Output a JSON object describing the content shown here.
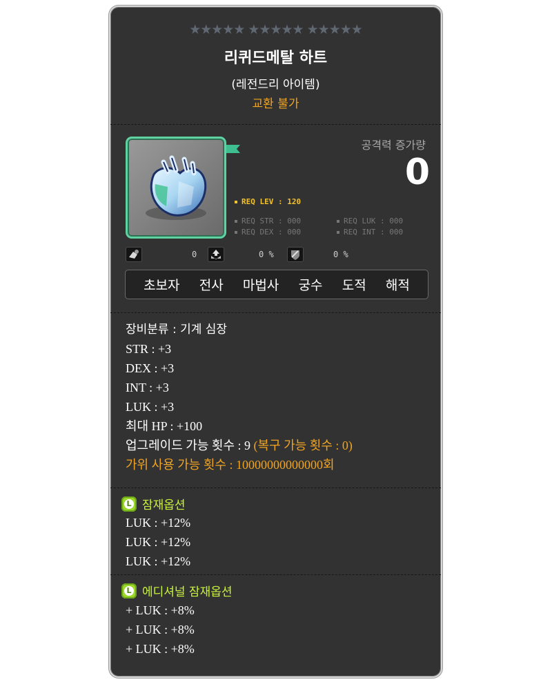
{
  "header": {
    "stars": "★★★★★ ★★★★★ ★★★★★",
    "item_name": "리퀴드메탈 하트",
    "grade": "(레전드리 아이템)",
    "trade_status": "교환 불가"
  },
  "attack": {
    "label": "공격력 증가량",
    "value": "0"
  },
  "requirements": {
    "level": "REQ LEV : 120",
    "str": "REQ STR : 000",
    "luk": "REQ LUK : 000",
    "dex": "REQ DEX : 000",
    "int": "REQ INT : 000"
  },
  "stat_icons": [
    {
      "icon": "pet-equip-icon",
      "value": "0"
    },
    {
      "icon": "upgrade-icon",
      "value": "0 %"
    },
    {
      "icon": "shield-icon",
      "value": "0 %"
    }
  ],
  "jobs": [
    "초보자",
    "전사",
    "마법사",
    "궁수",
    "도적",
    "해적"
  ],
  "stats": {
    "category": "장비분류 : 기계 심장",
    "str": "STR : +3",
    "dex": "DEX : +3",
    "int": "INT : +3",
    "luk": "LUK : +3",
    "hp": "최대 HP : +100",
    "upgrade": "업그레이드 가능 횟수 : 9",
    "restore": "(복구 가능 횟수 : 0)",
    "scissors": "가위 사용 가능 횟수 : 10000000000000회"
  },
  "potential": {
    "badge": "L",
    "title": "잠재옵션",
    "lines": [
      "LUK : +12%",
      "LUK : +12%",
      "LUK : +12%"
    ]
  },
  "additional": {
    "badge": "L",
    "title": "에디셔널 잠재옵션",
    "lines": [
      "+ LUK : +8%",
      "+ LUK : +8%",
      "+ LUK : +8%"
    ]
  },
  "colors": {
    "background": "#323232",
    "title": "#ffffff",
    "trade": "#f0a422",
    "req_level": "#f2c12e",
    "potential": "#c9f23a",
    "item_frame": "#5fd2a2"
  }
}
